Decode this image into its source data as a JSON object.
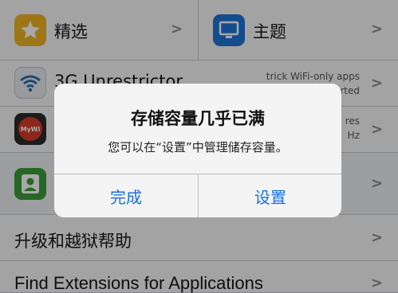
{
  "featured": {
    "label": "精选",
    "icon": "star-icon",
    "color": "#f0b323"
  },
  "themes": {
    "label": "主题",
    "icon": "monitor-icon",
    "color": "#1f76d8"
  },
  "tweak1": {
    "title": "3G Unrestrictor",
    "desc_line1": "trick WiFi-only apps",
    "desc_line2": "rted",
    "icon": "wifi-icon"
  },
  "tweak2": {
    "icon_text": "MyWi",
    "desc_line1": "res",
    "desc_line2": "Hz"
  },
  "contacts": {
    "icon": "contact-icon",
    "color": "#3a9d3a"
  },
  "upgrade": {
    "label": "升级和越狱帮助"
  },
  "find_ext": {
    "label": "Find Extensions for Applications"
  },
  "alert": {
    "title": "存储容量几乎已满",
    "message": "您可以在“设置”中管理储存容量。",
    "done_label": "完成",
    "settings_label": "设置",
    "button_color": "#1a6fe0"
  }
}
